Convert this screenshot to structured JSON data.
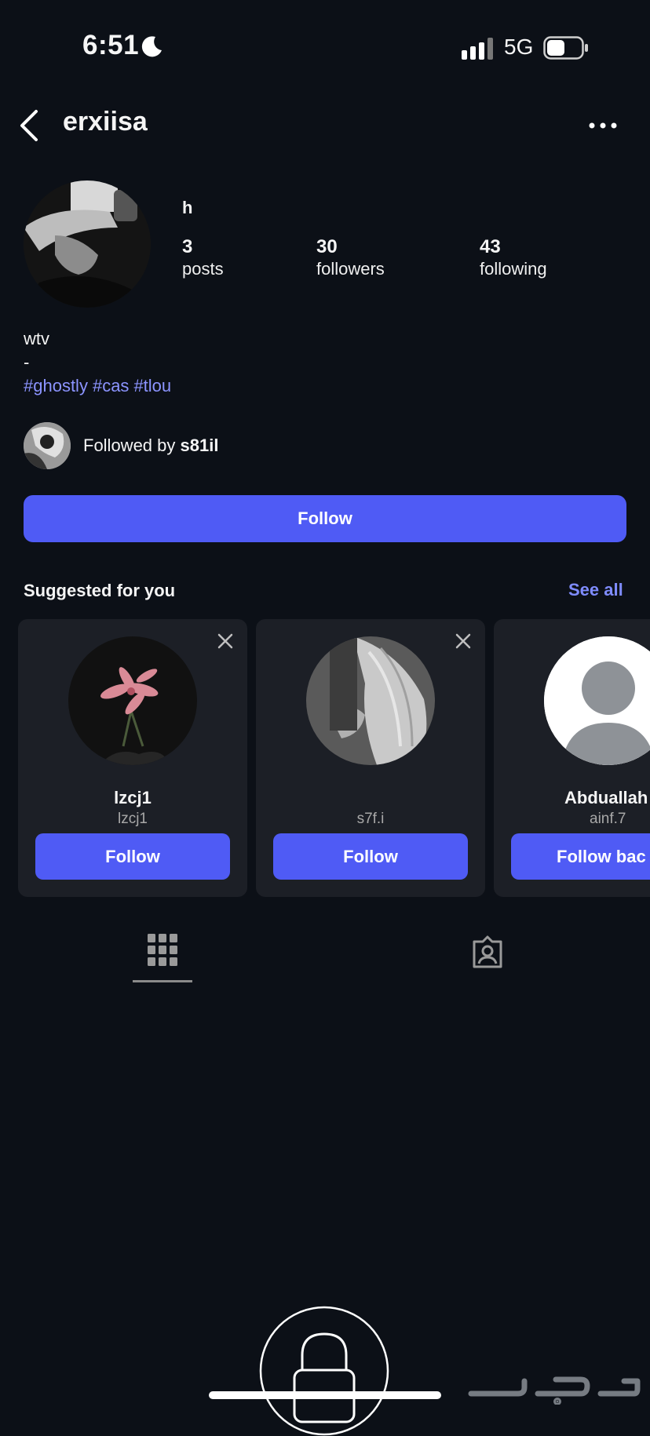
{
  "status_bar": {
    "time": "6:51",
    "network": "5G"
  },
  "header": {
    "username": "erxiisa"
  },
  "profile": {
    "display_name": "h",
    "stats": [
      {
        "value": "3",
        "label": "posts"
      },
      {
        "value": "30",
        "label": "followers"
      },
      {
        "value": "43",
        "label": "following"
      }
    ],
    "bio_lines": [
      "wtv",
      "-"
    ],
    "hashtags": [
      "#ghostly",
      "#cas",
      "#tlou"
    ],
    "followed_by_prefix": "Followed by",
    "followed_by_user": "s81il",
    "follow_label": "Follow"
  },
  "suggested": {
    "title": "Suggested for you",
    "see_all": "See all",
    "cards": [
      {
        "name": "lzcj1",
        "handle": "lzcj1",
        "button": "Follow"
      },
      {
        "name": "",
        "handle": "s7f.i",
        "button": "Follow"
      },
      {
        "name": "Abduallah",
        "handle": "ainf.7",
        "button": "Follow bac"
      }
    ]
  },
  "tabs": [
    "grid-icon",
    "tagged-icon"
  ],
  "colors": {
    "accent": "#4f5bf5",
    "background": "#0c1017",
    "link": "#8c94ff"
  }
}
